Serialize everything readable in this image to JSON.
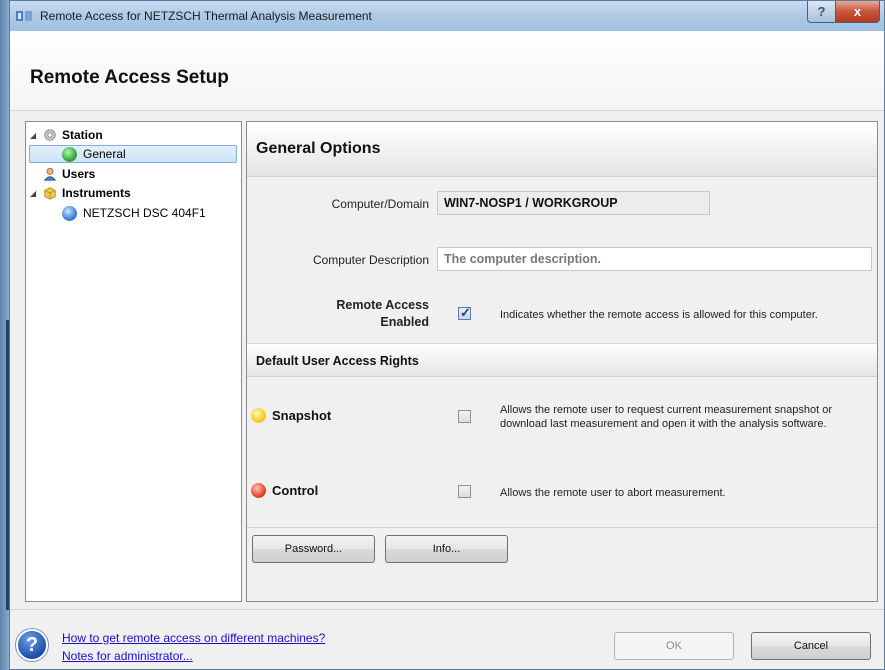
{
  "window": {
    "title": "Remote Access for NETZSCH Thermal Analysis Measurement",
    "help_glyph": "?",
    "close_glyph": "x"
  },
  "header": {
    "title": "Remote Access Setup"
  },
  "tree": {
    "items": [
      {
        "label": "Station"
      },
      {
        "label": "General"
      },
      {
        "label": "Users"
      },
      {
        "label": "Instruments"
      },
      {
        "label": "NETZSCH DSC 404F1"
      }
    ]
  },
  "general": {
    "heading": "General Options",
    "computer_domain_label": "Computer/Domain",
    "computer_domain_value": "WIN7-NOSP1 / WORKGROUP",
    "description_label": "Computer Description",
    "description_placeholder": "The computer description.",
    "remote_access_label_line1": "Remote Access",
    "remote_access_label_line2": "Enabled",
    "remote_access_desc": "Indicates whether the remote access is allowed for this computer."
  },
  "rights": {
    "heading": "Default User Access Rights",
    "snapshot_label": "Snapshot",
    "snapshot_desc_line1": "Allows the remote user to request current measurement snapshot or",
    "snapshot_desc_line2": "download last measurement and open it with the analysis software.",
    "control_label": "Control",
    "control_desc": "Allows the remote user to abort measurement."
  },
  "buttons": {
    "password": "Password...",
    "info": "Info...",
    "ok": "OK",
    "cancel": "Cancel"
  },
  "footer": {
    "help_glyph": "?",
    "link1": "How to get remote access on different machines?",
    "link2": "Notes for administrator..."
  },
  "state": {
    "remote_access_enabled": true,
    "snapshot_checked": false,
    "control_checked": false
  }
}
